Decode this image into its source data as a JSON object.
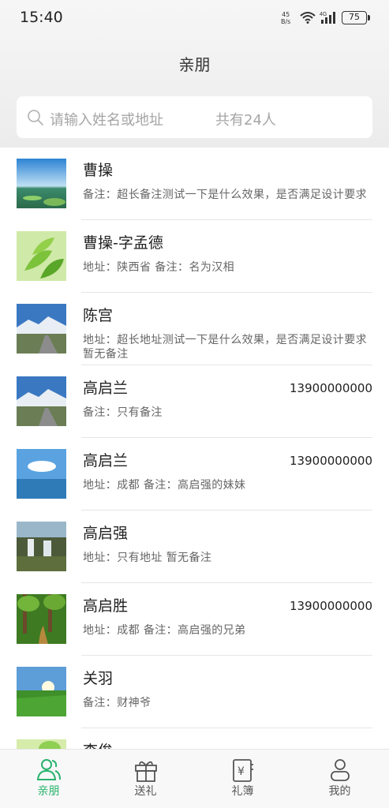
{
  "status_bar": {
    "time": "15:40",
    "net_speed_value": "45",
    "net_speed_unit": "B/s",
    "network_type": "4G",
    "battery": "75"
  },
  "header": {
    "title": "亲朋"
  },
  "search": {
    "placeholder": "请输入姓名或地址",
    "count_text": "共有24人"
  },
  "contacts": [
    {
      "name": "曹操",
      "phone": "",
      "subtitle": "备注：超长备注测试一下是什么效果，是否满足设计要求",
      "avatar": "lake-landscape"
    },
    {
      "name": "曹操-字孟德",
      "phone": "",
      "subtitle": "地址：陕西省  备注：名为汉相",
      "avatar": "green-leaves"
    },
    {
      "name": "陈宫",
      "phone": "",
      "subtitle": "地址：超长地址测试一下是什么效果，是否满足设计要求  暂无备注",
      "avatar": "mountain-road"
    },
    {
      "name": "高启兰",
      "phone": "13900000000",
      "subtitle": "备注：只有备注",
      "avatar": "mountain-road"
    },
    {
      "name": "高启兰",
      "phone": "13900000000",
      "subtitle": "地址：成都  备注：高启强的妹妹",
      "avatar": "sky-sea"
    },
    {
      "name": "高启强",
      "phone": "",
      "subtitle": "地址：只有地址  暂无备注",
      "avatar": "waterfall"
    },
    {
      "name": "高启胜",
      "phone": "13900000000",
      "subtitle": "地址：成都  备注：高启强的兄弟",
      "avatar": "forest-path"
    },
    {
      "name": "关羽",
      "phone": "",
      "subtitle": "备注：财神爷",
      "avatar": "green-field"
    },
    {
      "name": "李俊",
      "phone": "",
      "subtitle": "",
      "avatar": "green-plant"
    }
  ],
  "tabs": [
    {
      "label": "亲朋",
      "icon": "friends-icon",
      "active": true
    },
    {
      "label": "送礼",
      "icon": "gift-icon",
      "active": false
    },
    {
      "label": "礼簿",
      "icon": "ledger-icon",
      "active": false
    },
    {
      "label": "我的",
      "icon": "profile-icon",
      "active": false
    }
  ],
  "colors": {
    "accent": "#29b36d",
    "header_bg": "#f0f0f0",
    "divider": "#e6e6e6"
  }
}
